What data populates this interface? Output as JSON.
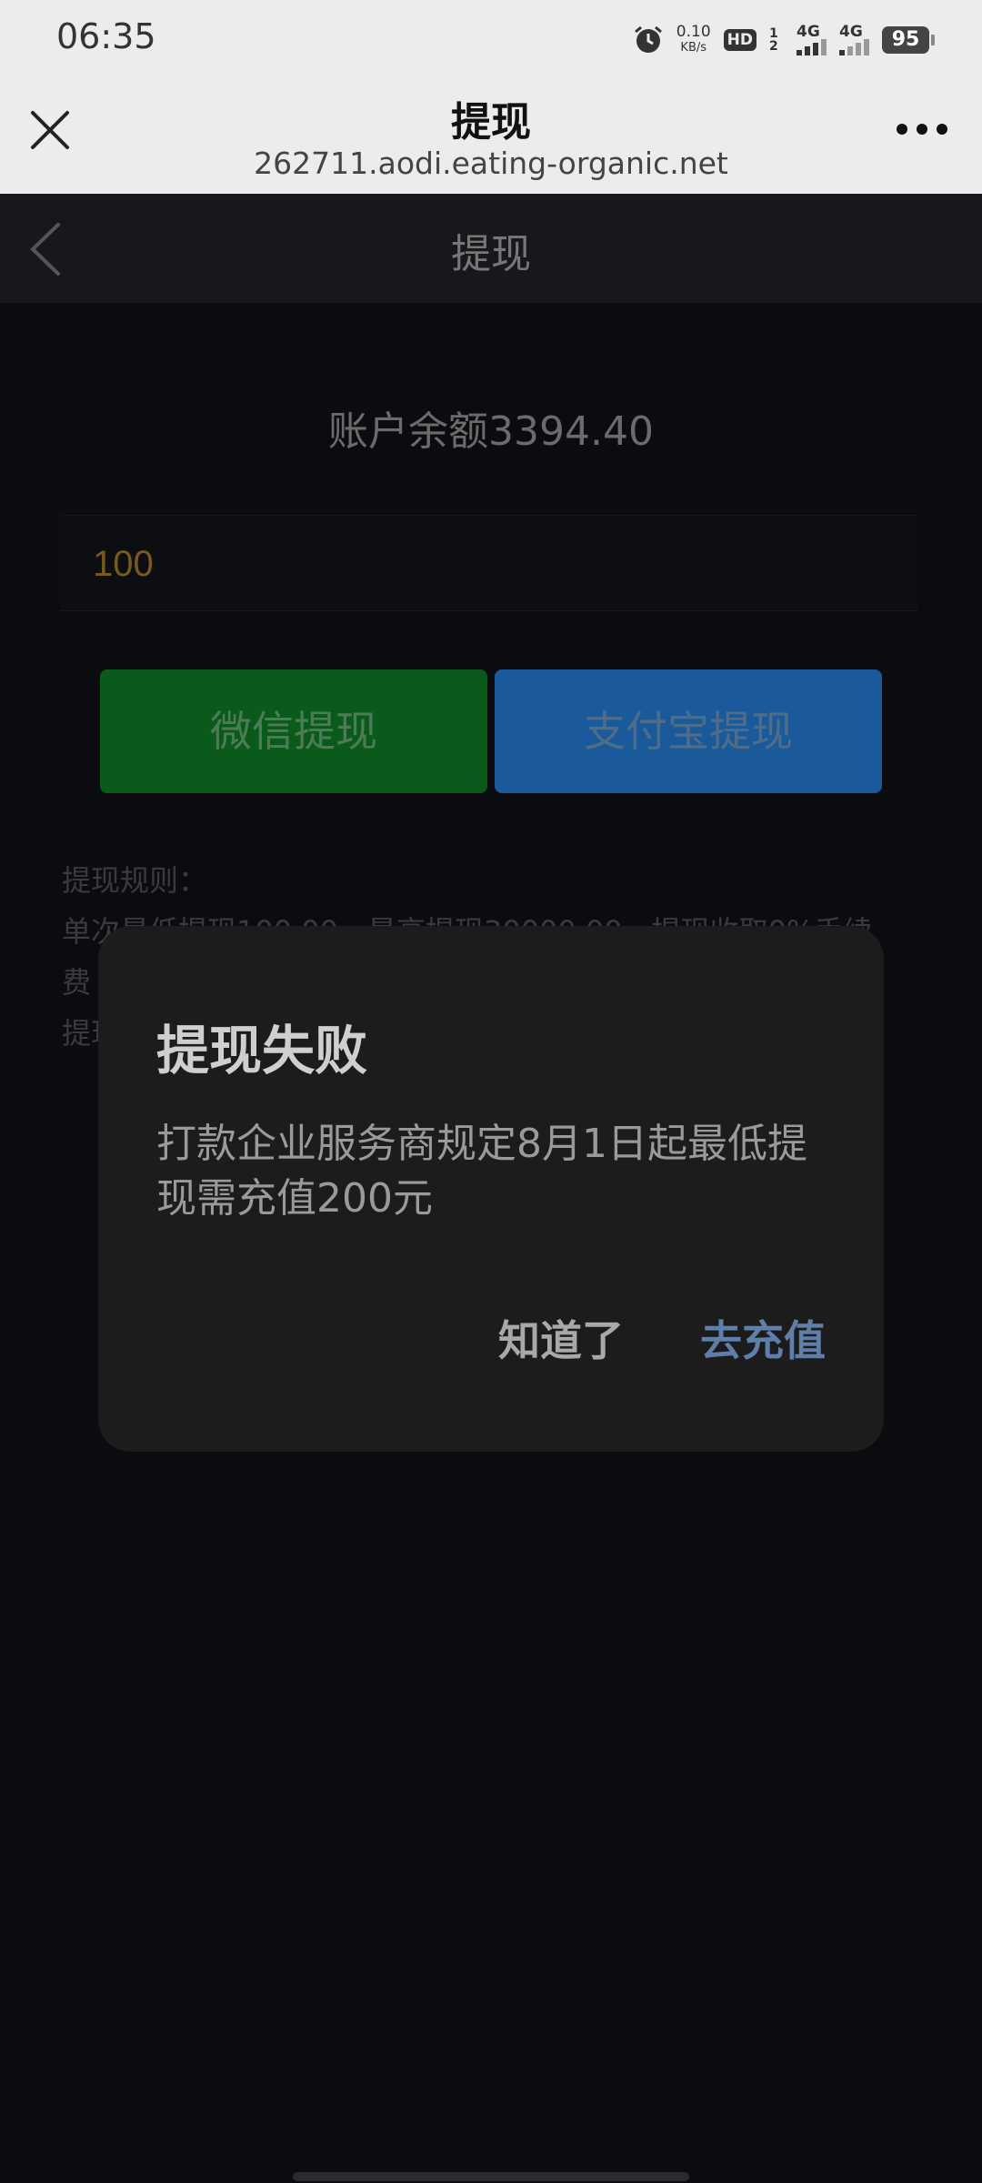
{
  "status_bar": {
    "time": "06:35",
    "net_speed_value": "0.10",
    "net_speed_unit": "KB/s",
    "hd_label": "HD",
    "sim_label": "1 2",
    "network_1": "4G",
    "network_2": "4G",
    "battery": "95",
    "icons": [
      "alarm-icon",
      "signal-icon",
      "battery-icon"
    ]
  },
  "browser": {
    "title": "提现",
    "url": "262711.aodi.eating-organic.net",
    "icons": [
      "close-icon",
      "more-icon"
    ]
  },
  "page": {
    "title": "提现",
    "back_icon": "chevron-left-icon",
    "balance": "账户余额3394.40",
    "amount_value": "100",
    "wechat_button": "微信提现",
    "alipay_button": "支付宝提现",
    "rules_title": "提现规则：",
    "rules_line1": "单次最低提现100.00，最高提现30000.00，提现收取0%手续",
    "rules_line2": "费",
    "rules_line3": "提现"
  },
  "dialog": {
    "title": "提现失败",
    "message": "打款企业服务商规定8月1日起最低提现需充值200元",
    "ok_button": "知道了",
    "recharge_button": "去充值"
  },
  "colors": {
    "wechat_green": "#0a5a1c",
    "alipay_blue": "#1a5a9a",
    "dialog_bg": "#1c1c1d",
    "recharge_accent": "#5f7ea8"
  }
}
